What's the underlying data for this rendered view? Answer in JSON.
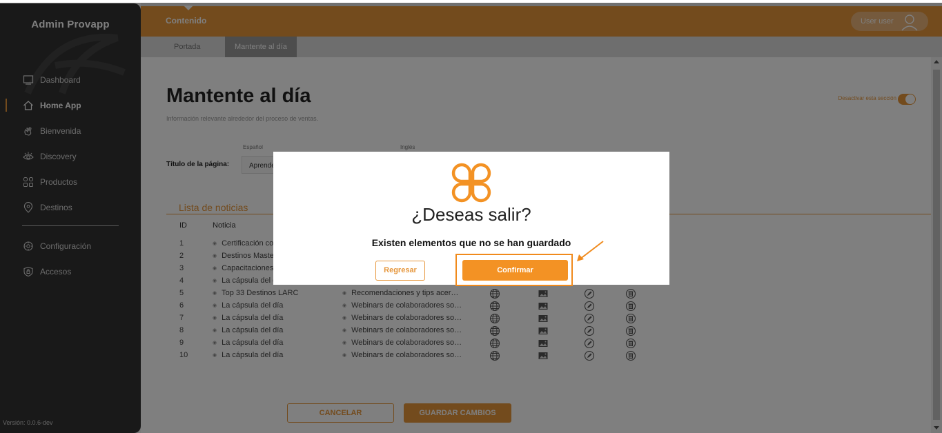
{
  "sidebar": {
    "brand": "Admin Provapp",
    "items": [
      {
        "label": "Dashboard",
        "icon": "monitor-icon"
      },
      {
        "label": "Home App",
        "icon": "home-icon",
        "active": true
      },
      {
        "label": "Bienvenida",
        "icon": "waving-hand-icon"
      },
      {
        "label": "Discovery",
        "icon": "eye-icon"
      },
      {
        "label": "Productos",
        "icon": "grid-icon"
      },
      {
        "label": "Destinos",
        "icon": "map-pin-icon"
      }
    ],
    "items_bottom": [
      {
        "label": "Configuración",
        "icon": "gear-icon"
      },
      {
        "label": "Accesos",
        "icon": "shield-icon"
      }
    ],
    "version": "Versión: 0.0.6-dev"
  },
  "topbar": {
    "title": "Contenido",
    "user_label": "User user"
  },
  "tabs": [
    {
      "label": "Portada"
    },
    {
      "label": "Mantente al día",
      "active": true
    }
  ],
  "page": {
    "title": "Mantente al día",
    "subtitle": "Información relevante alrededor del proceso de ventas.",
    "toggle_label": "Desactivar esta sección",
    "toggle_on": true,
    "lang_es": "Español",
    "lang_en": "Inglés",
    "field_label": "Título de la página:",
    "field_es_value": "Aprende",
    "news_heading": "Lista de noticias",
    "col_id": "ID",
    "col_news": "Noticia",
    "rows": [
      {
        "id": "1",
        "title": "Certificación co",
        "desc": ""
      },
      {
        "id": "2",
        "title": "Destinos Maste",
        "desc": ""
      },
      {
        "id": "3",
        "title": "Capacitaciones",
        "desc": ""
      },
      {
        "id": "4",
        "title": "La cápsula del c",
        "desc": ""
      },
      {
        "id": "5",
        "title": "Top 33 Destinos LARC",
        "desc": "Recomendaciones y tips acer…"
      },
      {
        "id": "6",
        "title": "La cápsula del día",
        "desc": "Webinars de colaboradores so…"
      },
      {
        "id": "7",
        "title": "La cápsula del día",
        "desc": "Webinars de colaboradores so…"
      },
      {
        "id": "8",
        "title": "La cápsula del día",
        "desc": "Webinars de colaboradores so…"
      },
      {
        "id": "9",
        "title": "La cápsula del día",
        "desc": "Webinars de colaboradores so…"
      },
      {
        "id": "10",
        "title": "La cápsula del día",
        "desc": "Webinars de colaboradores so…"
      }
    ],
    "cancel_label": "CANCELAR",
    "save_label": "GUARDAR CAMBIOS"
  },
  "modal": {
    "title": "¿Deseas salir?",
    "message": "Existen elementos que no se han guardado",
    "back_label": "Regresar",
    "confirm_label": "Confirmar"
  },
  "colors": {
    "accent": "#e6963b",
    "sidebar_bg": "#333333",
    "highlight": "#f08a1c"
  }
}
